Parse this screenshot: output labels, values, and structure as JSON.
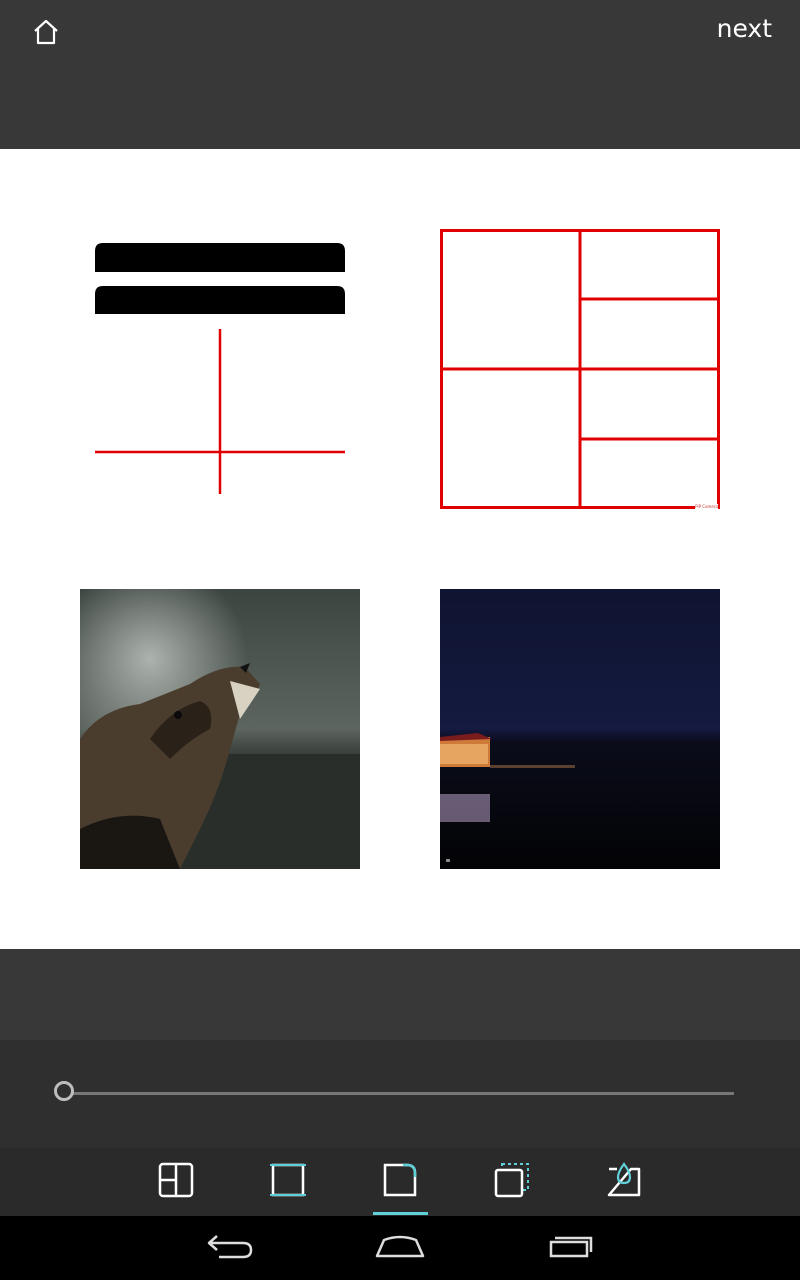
{
  "topbar": {
    "home_icon": "home-icon",
    "next_label": "next"
  },
  "collage": {
    "cells": [
      {
        "content": "layout-icon-graphic"
      },
      {
        "content": "grid-frame-graphic",
        "watermark": "PiP Camera"
      },
      {
        "content": "howling-dog-photo"
      },
      {
        "content": "night-lake-pier-photo"
      }
    ]
  },
  "slider": {
    "value": 0.0
  },
  "toolbar": {
    "tools": [
      {
        "icon": "layout-icon"
      },
      {
        "icon": "border-icon"
      },
      {
        "icon": "corner-radius-icon",
        "selected": true
      },
      {
        "icon": "shadow-frame-icon"
      },
      {
        "icon": "background-color-icon"
      }
    ]
  },
  "navbar": {
    "back_icon": "back-icon",
    "home_icon": "nav-home-icon",
    "recents_icon": "recents-icon"
  },
  "colors": {
    "accent": "#5fd0d8",
    "frame_red": "#e00000",
    "bar": "#383838"
  }
}
